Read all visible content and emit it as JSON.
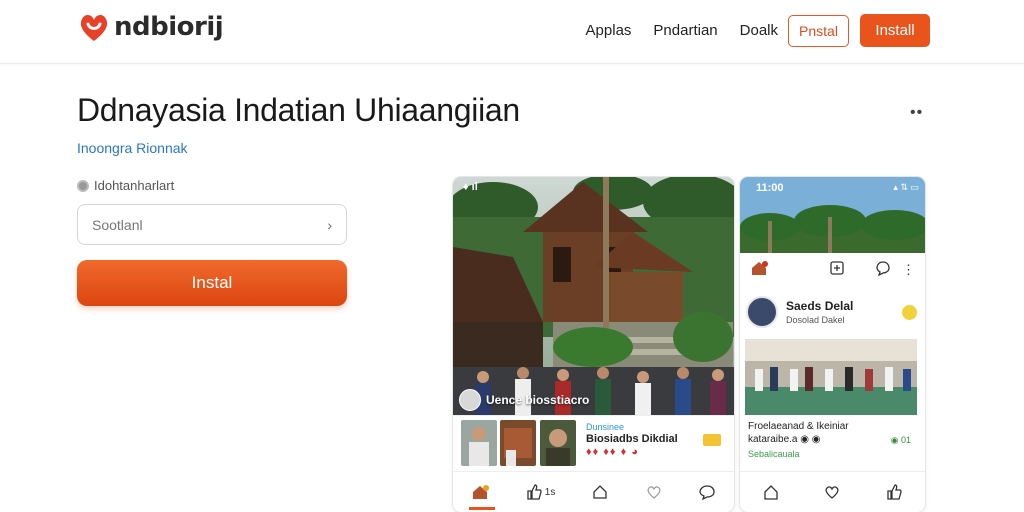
{
  "header": {
    "logo_text": "ndbiorij",
    "nav": [
      "Applas",
      "Pndartian",
      "Doalk"
    ],
    "outline_button": "Pnstal",
    "fill_button": "Install",
    "colors": {
      "accent": "#e8541c",
      "logo_red": "#e8412a"
    }
  },
  "main": {
    "title": "Ddnayasia Indatian Uhiaangiian",
    "subtitle": "Inoongra Rionnak",
    "field_label": "Idohtanharlart",
    "search_placeholder": "Sootlanl",
    "install_button": "Instal",
    "more_icon": "more-dots-icon"
  },
  "phone1": {
    "status": "♦ ıl",
    "overlay_text": "Uence biosstiacro",
    "strip_small": "Dunsinee",
    "strip_text": "Biosiadbs Dikdial",
    "strip_emoji": "♦♦ ♦♦ ♦ ◕",
    "count": "1s"
  },
  "phone2": {
    "status": "11:00",
    "status_right": "▴ ⇅ ▭",
    "post_name": "Saeds Delal",
    "post_sub": "Dosolad Dakel",
    "caption_line1": "Froelaeanad & Ikeiniar",
    "caption_line2": "kataraibe.a ◉ ◉",
    "caption_line3": "Sebalicauala",
    "count": "◉ 01"
  }
}
